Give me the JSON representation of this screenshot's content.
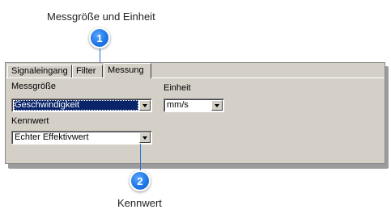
{
  "callouts": [
    {
      "number": "1",
      "title": "Messgröße und Einheit"
    },
    {
      "number": "2",
      "title": "Kennwert"
    }
  ],
  "tabs": [
    "Signaleingang",
    "Filter",
    "Messung"
  ],
  "active_tab": "Messung",
  "fields": {
    "messgroesse": {
      "label": "Messgröße",
      "value": "Geschwindigkeit"
    },
    "einheit": {
      "label": "Einheit",
      "value": "mm/s"
    },
    "kennwert": {
      "label": "Kennwert",
      "value": "Echter Effektivwert"
    }
  },
  "colors": {
    "badge": "#1f78e6",
    "panel": "#d4d0c8",
    "selection": "#0a246a"
  },
  "icons": {
    "dropdown": "chevron-down-icon"
  }
}
